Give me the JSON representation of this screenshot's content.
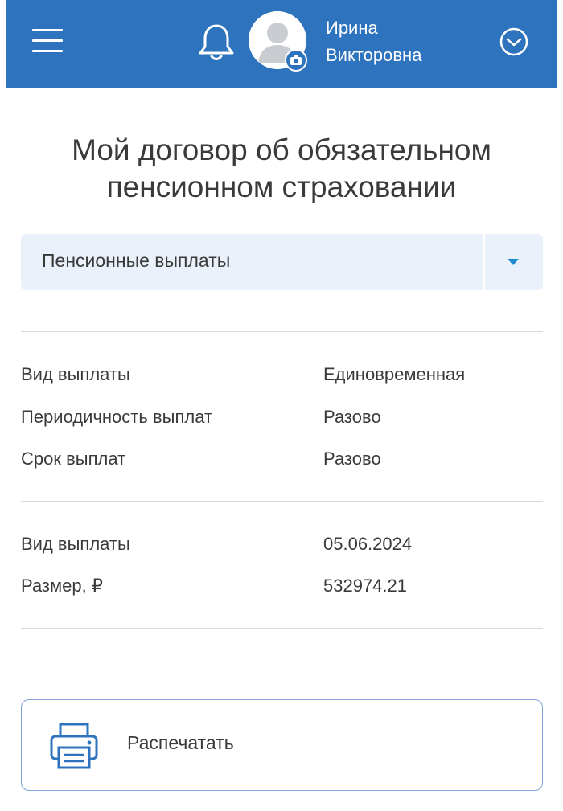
{
  "header": {
    "user_first_name": "Ирина",
    "user_patronymic": "Викторовна",
    "icons": [
      "menu-icon",
      "bell-icon",
      "avatar",
      "camera-icon",
      "chevron-down-circle-icon"
    ],
    "background_color": "#2e73bd"
  },
  "page": {
    "title_line1": "Мой договор об обязательном",
    "title_line2": "пенсионном страховании"
  },
  "payment_select": {
    "value": "Пенсионные выплаты"
  },
  "details_group1": [
    {
      "label": "Вид выплаты",
      "value": "Единовременная"
    },
    {
      "label": "Периодичность выплат",
      "value": "Разово"
    },
    {
      "label": "Срок выплат",
      "value": "Разово"
    }
  ],
  "details_group2": [
    {
      "label": "Вид выплаты",
      "value": "05.06.2024"
    },
    {
      "label": "Размер, ₽",
      "value": "532974.21"
    }
  ],
  "print_button": {
    "label": "Распечатать",
    "icon": "printer-icon"
  }
}
